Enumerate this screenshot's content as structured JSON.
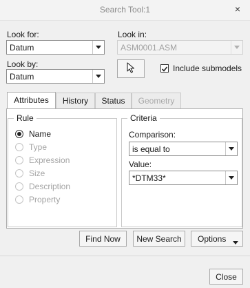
{
  "window": {
    "title": "Search Tool:1",
    "close_glyph": "×"
  },
  "look_for": {
    "label": "Look for:",
    "value": "Datum"
  },
  "look_by": {
    "label": "Look by:",
    "value": "Datum"
  },
  "look_in": {
    "label": "Look in:",
    "value": "ASM0001.ASM"
  },
  "include_submodels": {
    "label": "Include submodels",
    "checked": true
  },
  "select_icon": "cursor-arrow-icon",
  "tabs": [
    {
      "label": "Attributes",
      "active": true,
      "enabled": true
    },
    {
      "label": "History",
      "active": false,
      "enabled": true
    },
    {
      "label": "Status",
      "active": false,
      "enabled": true
    },
    {
      "label": "Geometry",
      "active": false,
      "enabled": false
    }
  ],
  "rule": {
    "title": "Rule",
    "options": [
      {
        "label": "Name",
        "checked": true,
        "enabled": true
      },
      {
        "label": "Type",
        "checked": false,
        "enabled": false
      },
      {
        "label": "Expression",
        "checked": false,
        "enabled": false
      },
      {
        "label": "Size",
        "checked": false,
        "enabled": false
      },
      {
        "label": "Description",
        "checked": false,
        "enabled": false
      },
      {
        "label": "Property",
        "checked": false,
        "enabled": false
      }
    ]
  },
  "criteria": {
    "title": "Criteria",
    "comparison_label": "Comparison:",
    "comparison_value": "is equal to",
    "value_label": "Value:",
    "value_value": "*DTM33*"
  },
  "actions": {
    "find_now": "Find Now",
    "new_search": "New Search",
    "options": "Options"
  },
  "footer": {
    "close": "Close"
  }
}
